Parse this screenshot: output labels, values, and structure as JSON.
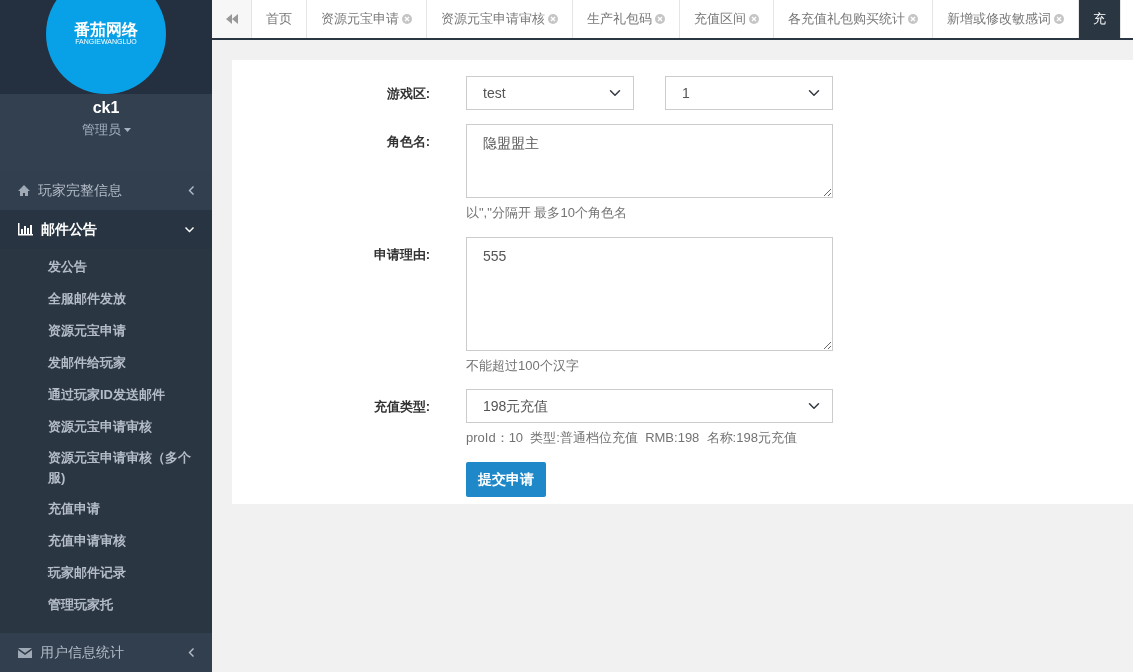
{
  "sidebar": {
    "logo": {
      "title": "番茄网络",
      "subtitle": "FANGIEWANGLUO"
    },
    "user": {
      "name": "ck1",
      "role": "管理员"
    },
    "menu": [
      {
        "label": "玩家完整信息",
        "expanded": false
      },
      {
        "label": "邮件公告",
        "expanded": true,
        "children": [
          {
            "label": "发公告"
          },
          {
            "label": "全服邮件发放"
          },
          {
            "label": "资源元宝申请"
          },
          {
            "label": "发邮件给玩家"
          },
          {
            "label": "通过玩家ID发送邮件"
          },
          {
            "label": "资源元宝申请审核"
          },
          {
            "label": "资源元宝申请审核（多个服)"
          },
          {
            "label": "充值申请"
          },
          {
            "label": "充值申请审核"
          },
          {
            "label": "玩家邮件记录"
          },
          {
            "label": "管理玩家托"
          }
        ]
      },
      {
        "label": "用户信息统计",
        "expanded": false
      }
    ]
  },
  "tabs": [
    {
      "label": "首页",
      "closable": false,
      "selected": false
    },
    {
      "label": "资源元宝申请",
      "closable": true,
      "selected": false
    },
    {
      "label": "资源元宝申请审核",
      "closable": true,
      "selected": false
    },
    {
      "label": "生产礼包码",
      "closable": true,
      "selected": false
    },
    {
      "label": "充值区间",
      "closable": true,
      "selected": false
    },
    {
      "label": "各充值礼包购买统计",
      "closable": true,
      "selected": false
    },
    {
      "label": "新增或修改敏感词",
      "closable": true,
      "selected": false
    },
    {
      "label": "充",
      "closable": false,
      "selected": true
    }
  ],
  "form": {
    "fields": [
      {
        "kind": "selects",
        "label": "游戏区:",
        "values": [
          "test",
          "1"
        ]
      },
      {
        "kind": "textarea",
        "label": "角色名:",
        "value": "隐盟盟主",
        "help": "以\",\"分隔开 最多10个角色名"
      },
      {
        "kind": "textarea",
        "label": "申请理由:",
        "value": "555",
        "help": "不能超过100个汉字"
      },
      {
        "kind": "select",
        "label": "充值类型:",
        "values": [
          "198元充值"
        ],
        "help": "proId：10  类型:普通档位充值  RMB:198  名称:198元充值"
      }
    ],
    "submit": "提交申请"
  }
}
